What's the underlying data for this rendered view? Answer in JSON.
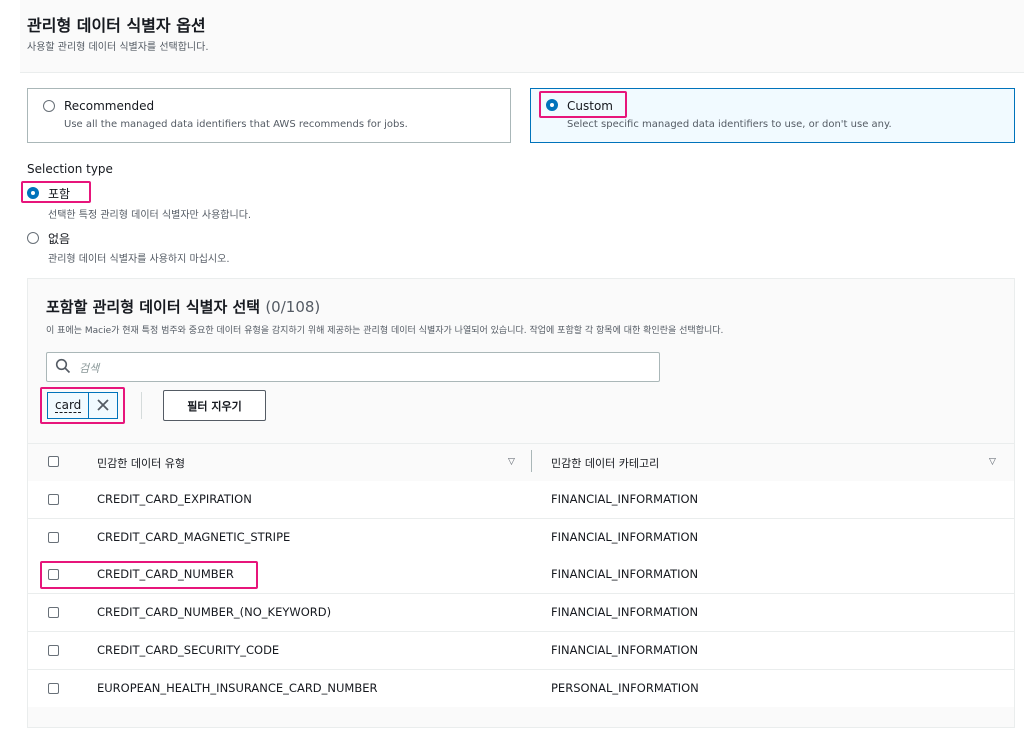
{
  "section": {
    "title": "관리형 데이터 식별자 옵션",
    "description": "사용할 관리형 데이터 식별자를 선택합니다."
  },
  "options": {
    "recommended": {
      "label": "Recommended",
      "description": "Use all the managed data identifiers that AWS recommends for jobs.",
      "selected": false
    },
    "custom": {
      "label": "Custom",
      "description": "Select specific managed data identifiers to use, or don't use any.",
      "selected": true
    }
  },
  "selection_type": {
    "label": "Selection type",
    "include": {
      "label": "포함",
      "description": "선택한 특정 관리형 데이터 식별자만 사용합니다.",
      "selected": true
    },
    "none": {
      "label": "없음",
      "description": "관리형 데이터 식별자를 사용하지 마십시오.",
      "selected": false
    }
  },
  "table_panel": {
    "title": "포함할 관리형 데이터 식별자 선택",
    "count": "(0/108)",
    "description": "이 표에는 Macie가 현재 특정 범주와 중요한 데이터 유형을 감지하기 위해 제공하는 관리형 데이터 식별자가 나열되어 있습니다. 작업에 포함할 각 항목에 대한 확인란을 선택합니다.",
    "search_placeholder": "검색",
    "filter_token": "card",
    "clear_filter_label": "필터 지우기",
    "columns": [
      "민감한 데이터 유형",
      "민감한 데이터 카테고리"
    ],
    "rows": [
      {
        "type": "CREDIT_CARD_EXPIRATION",
        "category": "FINANCIAL_INFORMATION"
      },
      {
        "type": "CREDIT_CARD_MAGNETIC_STRIPE",
        "category": "FINANCIAL_INFORMATION"
      },
      {
        "type": "CREDIT_CARD_NUMBER",
        "category": "FINANCIAL_INFORMATION"
      },
      {
        "type": "CREDIT_CARD_NUMBER_(NO_KEYWORD)",
        "category": "FINANCIAL_INFORMATION"
      },
      {
        "type": "CREDIT_CARD_SECURITY_CODE",
        "category": "FINANCIAL_INFORMATION"
      },
      {
        "type": "EUROPEAN_HEALTH_INSURANCE_CARD_NUMBER",
        "category": "PERSONAL_INFORMATION"
      }
    ]
  },
  "colors": {
    "accent": "#0073bb",
    "highlight": "#e7157b"
  }
}
